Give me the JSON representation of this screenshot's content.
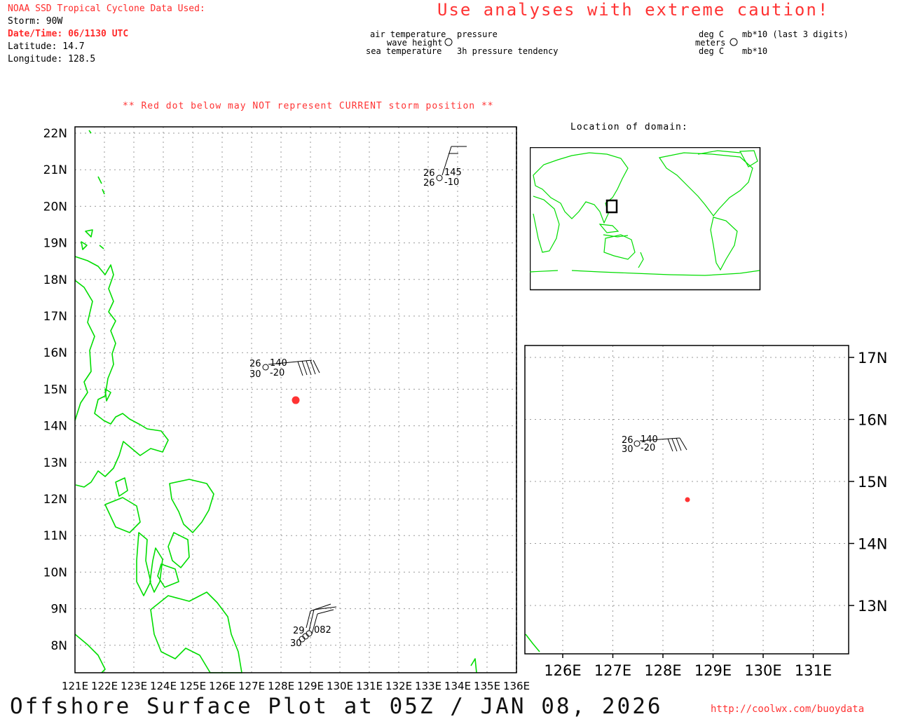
{
  "header": {
    "source_title": "NOAA SSD Tropical Cyclone Data Used:",
    "storm": "Storm: 90W",
    "datetime": "Date/Time: 06/1130 UTC",
    "latitude": "Latitude: 14.7",
    "longitude": "Longitude: 128.5",
    "caution": "Use analyses with extreme caution!"
  },
  "legend": {
    "left_labels": [
      "air temperature",
      "wave height",
      "sea temperature"
    ],
    "right_labels": [
      "pressure",
      "3h pressure tendency"
    ],
    "unit_left": [
      "deg C",
      "meters",
      "deg C"
    ],
    "unit_right": [
      "mb*10 (last 3 digits)",
      "mb*10"
    ]
  },
  "warning_note": "** Red dot below may NOT represent CURRENT storm position **",
  "location_label": "Location of domain:",
  "footer": {
    "title": "Offshore Surface Plot at 05Z / JAN 08, 2026",
    "url": "http://coolwx.com/buoydata"
  },
  "colors": {
    "coast": "#00dd00",
    "storm_dot": "#ff3333",
    "warning": "#ff3333"
  },
  "main_map": {
    "lon_labels": [
      "121E",
      "122E",
      "123E",
      "124E",
      "125E",
      "126E",
      "127E",
      "128E",
      "129E",
      "130E",
      "131E",
      "132E",
      "133E",
      "134E",
      "135E",
      "136E"
    ],
    "lat_labels": [
      "22N",
      "21N",
      "20N",
      "19N",
      "18N",
      "17N",
      "16N",
      "15N",
      "14N",
      "13N",
      "12N",
      "11N",
      "10N",
      "9N",
      "8N"
    ],
    "storm": {
      "lat": 14.7,
      "lon": 128.5
    },
    "stations": [
      {
        "air": "26",
        "sea": "26",
        "pressure": "145",
        "tendency": "-10"
      },
      {
        "air": "26",
        "sea": "30",
        "pressure": "140",
        "tendency": "-20"
      },
      {
        "air": "29",
        "sea": "30",
        "pressure": "082",
        "tendency": ""
      }
    ]
  },
  "zoom_map": {
    "lon_labels": [
      "126E",
      "127E",
      "128E",
      "129E",
      "130E",
      "131E"
    ],
    "lat_labels": [
      "17N",
      "16N",
      "15N",
      "14N",
      "13N"
    ],
    "station": {
      "air": "26",
      "sea": "30",
      "pressure": "140",
      "tendency": "-20"
    }
  }
}
